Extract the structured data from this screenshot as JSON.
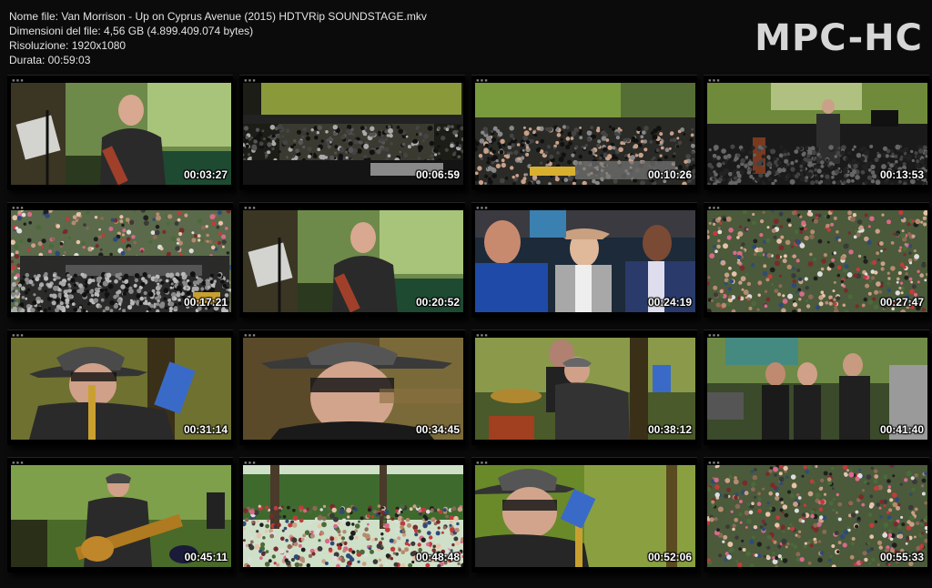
{
  "file_info": {
    "name": "Nome file: Van Morrison - Up on Cyprus Avenue (2015) HDTVRip SOUNDSTAGE.mkv",
    "size": "Dimensioni del file: 4,56 GB (4.899.409.074 bytes)",
    "resolution": "Risoluzione: 1920x1080",
    "duration": "Durata: 00:59:03"
  },
  "logo": "MPC-HC",
  "thumbnails": [
    {
      "time": "00:03:27",
      "scene": "guitarist-green"
    },
    {
      "time": "00:06:59",
      "scene": "stage-wide"
    },
    {
      "time": "00:10:26",
      "scene": "stage-wide-2"
    },
    {
      "time": "00:13:53",
      "scene": "stage-singer"
    },
    {
      "time": "00:17:21",
      "scene": "crowd-aerial"
    },
    {
      "time": "00:20:52",
      "scene": "guitarist-green"
    },
    {
      "time": "00:24:19",
      "scene": "audience-closeup"
    },
    {
      "time": "00:27:47",
      "scene": "crowd"
    },
    {
      "time": "00:31:14",
      "scene": "singer-hat"
    },
    {
      "time": "00:34:45",
      "scene": "singer-closeup"
    },
    {
      "time": "00:38:12",
      "scene": "singer-drums"
    },
    {
      "time": "00:41:40",
      "scene": "people-trees"
    },
    {
      "time": "00:45:11",
      "scene": "guitar-singer"
    },
    {
      "time": "00:48:48",
      "scene": "crowd-trees"
    },
    {
      "time": "00:52:06",
      "scene": "singer-hat-side"
    },
    {
      "time": "00:55:33",
      "scene": "crowd"
    }
  ]
}
